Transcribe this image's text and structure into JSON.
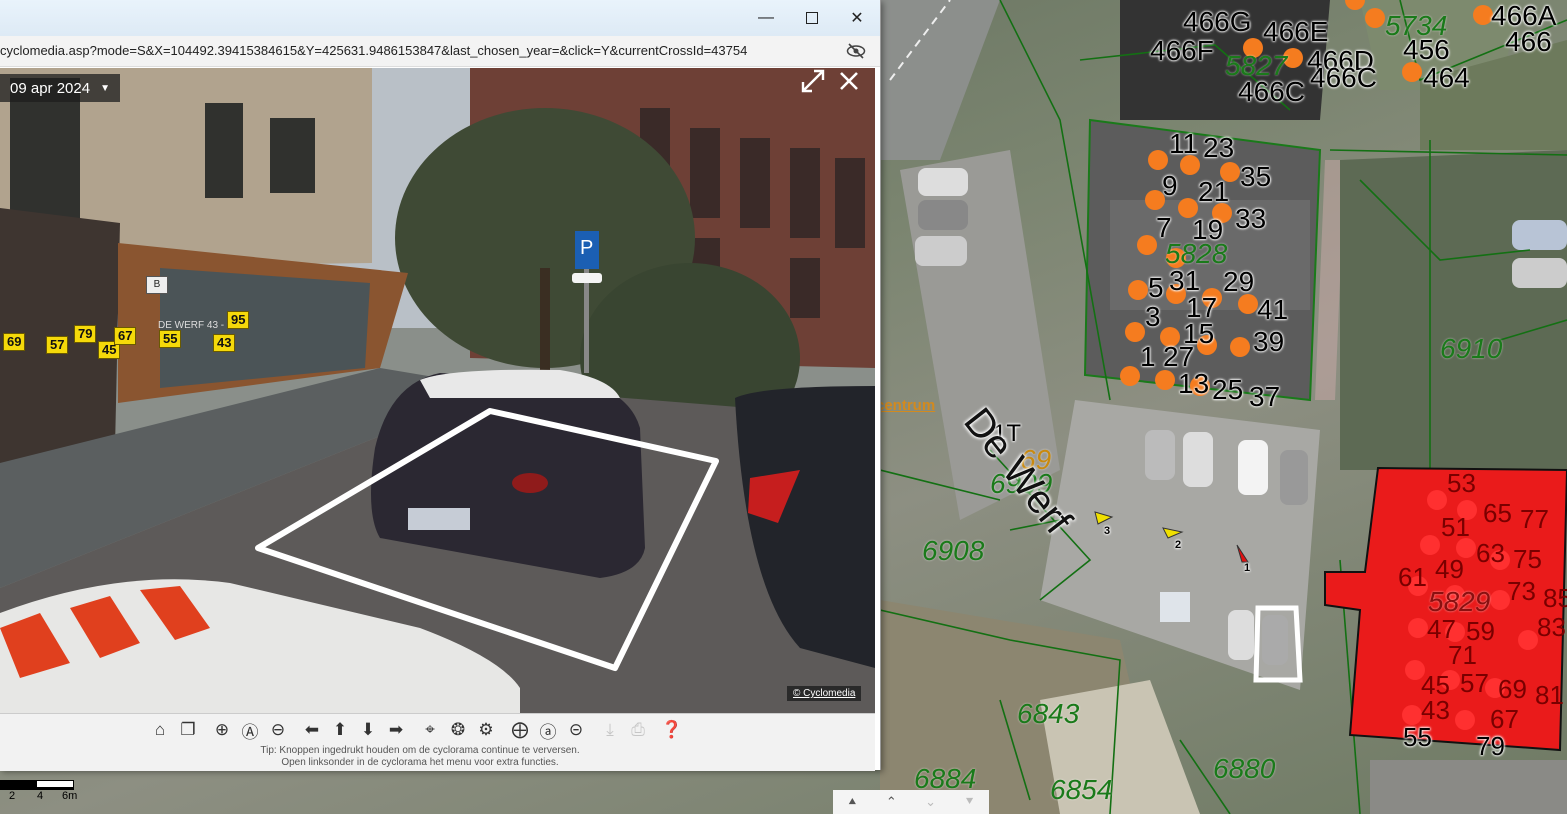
{
  "window": {
    "url": "cyclomedia.asp?mode=S&X=104492.39415384615&Y=425631.9486153847&last_chosen_year=&click=Y&currentCrossId=43754",
    "minimize_icon": "minimize-icon",
    "maximize_icon": "maximize-icon",
    "close_icon": "close-icon"
  },
  "panorama": {
    "date": "09 apr 2024",
    "copyright": "© Cyclomedia",
    "building_sign": "B",
    "store_sign": "DE WERF 43 - 89",
    "house_numbers": [
      "69",
      "57",
      "79",
      "45",
      "67",
      "55",
      "95",
      "43"
    ],
    "overlay_color": "#ffffff"
  },
  "toolbar": {
    "tip_line1": "Tip: Knoppen ingedrukt houden om de cyclorama continue te verversen.",
    "tip_line2": "Open linksonder in de cyclorama het menu voor extra functies.",
    "icons": [
      "home-icon",
      "copy-icon",
      "zoom-in-icon",
      "zoom-reset-icon",
      "zoom-out-icon",
      "arrow-left-icon",
      "arrow-up-icon",
      "arrow-down-icon",
      "arrow-right-icon",
      "locate-icon",
      "locate-auto-icon",
      "locate-off-icon",
      "overlay-add-icon",
      "overlay-auto-icon",
      "overlay-remove-icon",
      "measure-icon",
      "print-icon",
      "help-icon"
    ]
  },
  "map": {
    "street_name": "De Werf",
    "poi_link": "centrum",
    "labels_top": [
      "466G",
      "466E",
      "466A",
      "466F",
      "466D",
      "456",
      "466",
      "466C",
      "466C",
      "464"
    ],
    "parcel_numbers": [
      "5734",
      "5827",
      "5828",
      "6910",
      "6909",
      "6908",
      "6843",
      "6884",
      "6854",
      "6880",
      "5829",
      "69"
    ],
    "unit_numbers": [
      "11",
      "23",
      "35",
      "9",
      "21",
      "7",
      "19",
      "33",
      "5",
      "31",
      "29",
      "3",
      "17",
      "41",
      "15",
      "39",
      "1",
      "27",
      "13",
      "25",
      "37",
      "1T"
    ],
    "red_unit_numbers": [
      "53",
      "65",
      "77",
      "51",
      "63",
      "75",
      "61",
      "49",
      "73",
      "85",
      "47",
      "59",
      "83",
      "71",
      "45",
      "57",
      "69",
      "81",
      "43",
      "67",
      "55",
      "79"
    ],
    "marker_labels": [
      "3",
      "2",
      "1"
    ],
    "highlight_color": "#ea1b1b",
    "dot_color": "#f57c1f",
    "parcel_color": "#1a7a1a",
    "scale": [
      "2",
      "4",
      "6m"
    ]
  }
}
